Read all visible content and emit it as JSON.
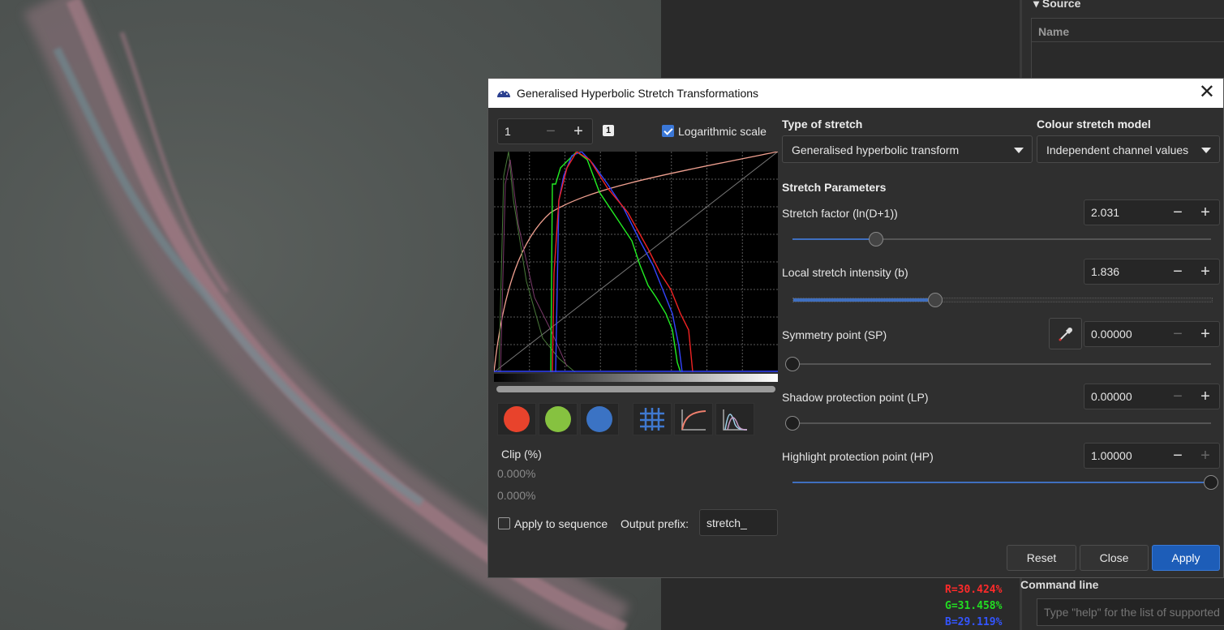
{
  "source_panel": {
    "header": "Source",
    "name_col": "Name"
  },
  "command_line": {
    "label": "Command line",
    "placeholder": "Type \"help\" for the list of supported"
  },
  "pixel_readout": {
    "r": "R=30.424%",
    "g": "G=31.458%",
    "b": "B=29.119%"
  },
  "dialog": {
    "title": "Generalised Hyperbolic Stretch Transformations",
    "history": {
      "value": "1",
      "badge": "1"
    },
    "log_scale": {
      "label": "Logarithmic scale",
      "checked": true
    },
    "type_of_stretch": {
      "label": "Type of stretch",
      "value": "Generalised hyperbolic transform"
    },
    "colour_model": {
      "label": "Colour stretch model",
      "value": "Independent channel values"
    },
    "params_title": "Stretch Parameters",
    "params": [
      {
        "label": "Stretch factor (ln(D+1))",
        "value": "2.031",
        "slider": 0.2
      },
      {
        "label": "Local stretch intensity (b)",
        "value": "1.836",
        "slider": 0.34
      },
      {
        "label": "Symmetry point (SP)",
        "value": "0.00000",
        "slider": 0.0
      },
      {
        "label": "Shadow protection point (LP)",
        "value": "0.00000",
        "slider": 0.0
      },
      {
        "label": "Highlight protection point (HP)",
        "value": "1.00000",
        "slider": 1.0
      }
    ],
    "clip": {
      "label": "Clip (%)",
      "low": "0.000%",
      "high": "0.000%"
    },
    "apply_sequence": {
      "label": "Apply to sequence",
      "checked": false
    },
    "output_prefix": {
      "label": "Output prefix:",
      "value": "stretch_"
    },
    "buttons": {
      "reset": "Reset",
      "close": "Close",
      "apply": "Apply"
    },
    "channel_colors": {
      "red": "#e8432c",
      "green": "#86c240",
      "blue": "#3b73c4"
    }
  }
}
